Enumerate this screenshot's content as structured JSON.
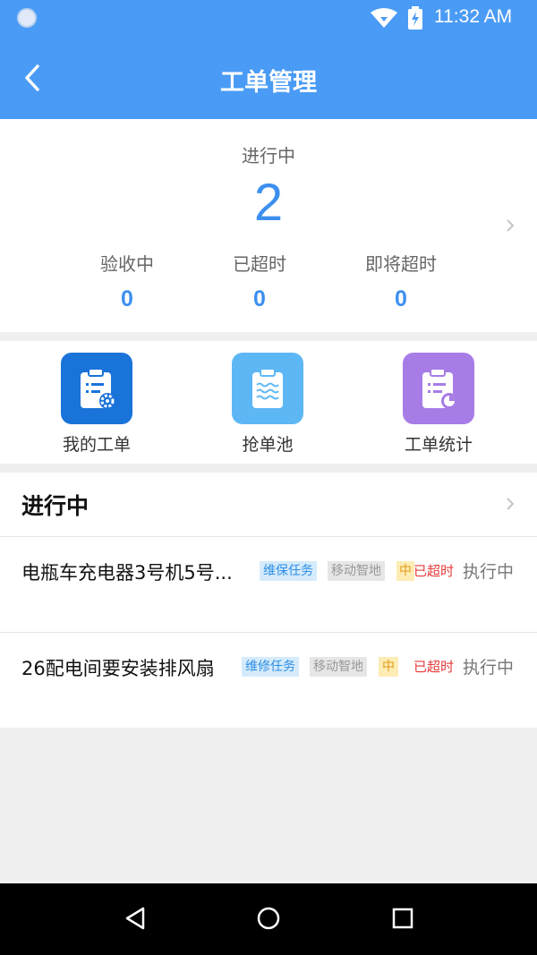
{
  "status_bar": {
    "time": "11:32 AM",
    "icons": [
      "notification-dot-icon",
      "wifi-icon",
      "battery-charging-icon"
    ]
  },
  "header": {
    "title": "工单管理",
    "back_icon": "chevron-left-icon"
  },
  "summary": {
    "main_label": "进行中",
    "main_count": "2",
    "stats": [
      {
        "label": "验收中",
        "value": "0"
      },
      {
        "label": "已超时",
        "value": "0"
      },
      {
        "label": "即将超时",
        "value": "0"
      }
    ]
  },
  "actions": [
    {
      "label": "我的工单",
      "icon": "clipboard-gear-icon",
      "color": "#1a73d9"
    },
    {
      "label": "抢单池",
      "icon": "clipboard-waves-icon",
      "color": "#5db7f5"
    },
    {
      "label": "工单统计",
      "icon": "clipboard-chart-icon",
      "color": "#a77ce6"
    }
  ],
  "list": {
    "title": "进行中",
    "items": [
      {
        "name": "电瓶车充电器3号机5号...",
        "type_tag": "维保任务",
        "org_tag": "移动智地",
        "priority_tag": "中",
        "overdue": "已超时",
        "status": "执行中"
      },
      {
        "name": "26配电间要安装排风扇",
        "type_tag": "维修任务",
        "org_tag": "移动智地",
        "priority_tag": "中",
        "overdue": "已超时",
        "status": "执行中"
      }
    ]
  },
  "colors": {
    "primary": "#4a9bf5",
    "count": "#3c8ff0",
    "overdue": "#e53b3b"
  },
  "navbar": {
    "icons": [
      "nav-back-icon",
      "nav-home-icon",
      "nav-recents-icon"
    ]
  }
}
